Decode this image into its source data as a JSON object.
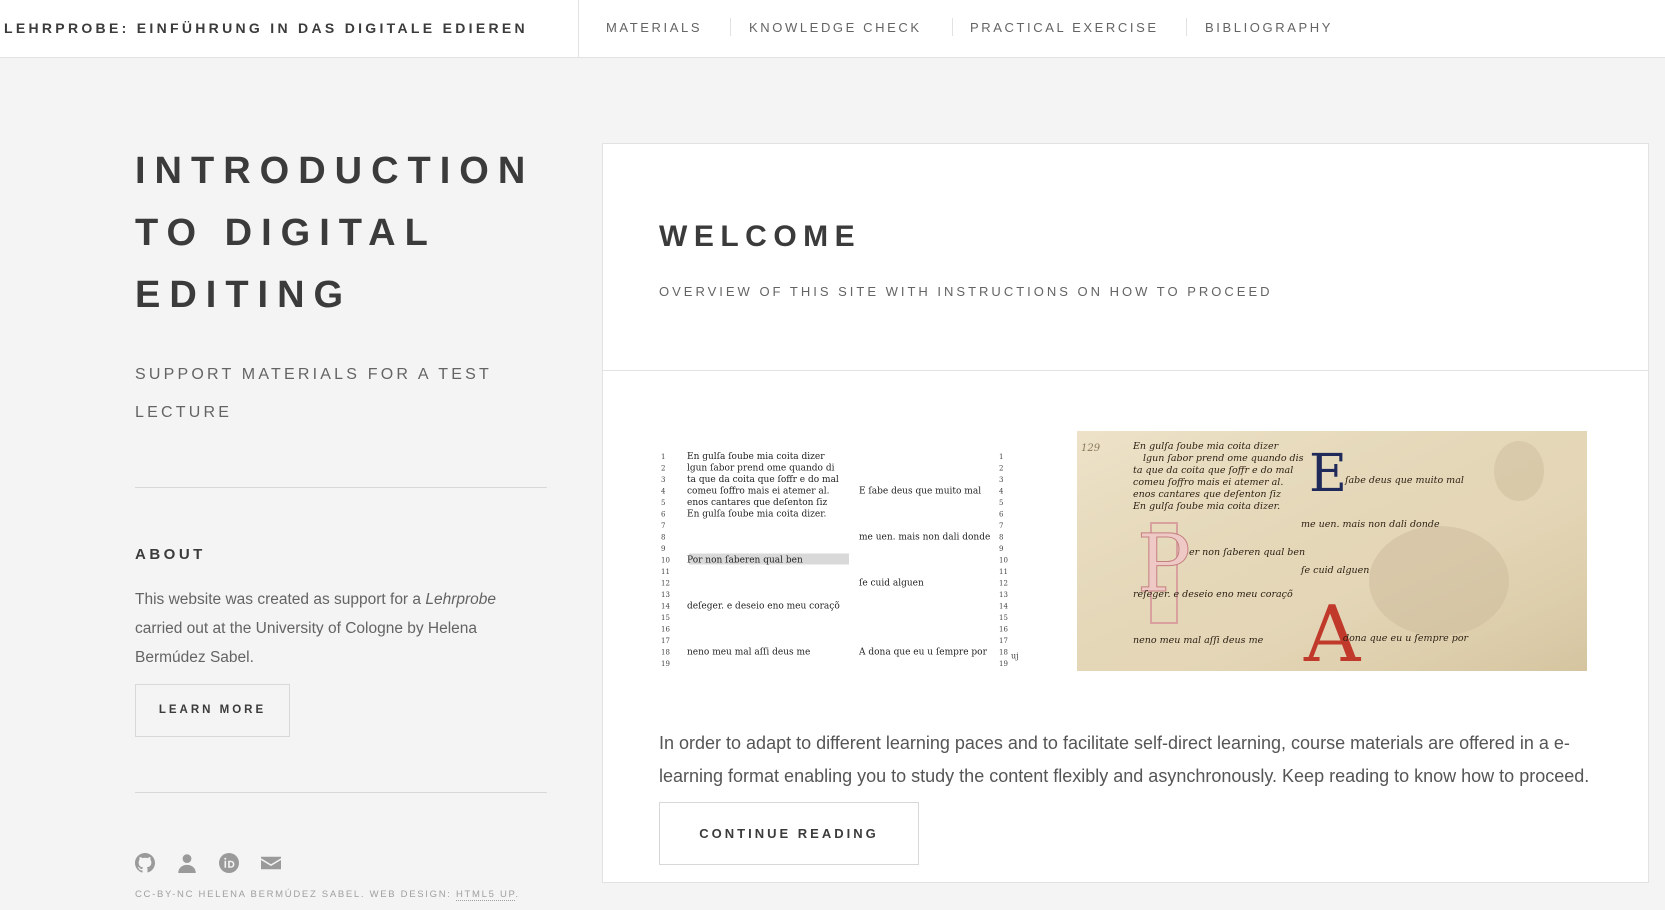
{
  "header": {
    "site_title": "LEHRPROBE: EINFÜHRUNG IN DAS DIGITALE EDIEREN",
    "nav": [
      {
        "label": "MATERIALS"
      },
      {
        "label": "KNOWLEDGE CHECK"
      },
      {
        "label": "PRACTICAL EXERCISE"
      },
      {
        "label": "BIBLIOGRAPHY"
      }
    ]
  },
  "sidebar": {
    "title": "INTRODUCTION TO DIGITAL EDITING",
    "subtitle": "SUPPORT MATERIALS FOR A TEST LECTURE",
    "about_heading": "ABOUT",
    "about_text_1": "This website was created as support for a ",
    "about_text_em": "Lehrprobe",
    "about_text_2": " carried out at the University of Cologne by Helena Bermúdez Sabel.",
    "learn_more_label": "LEARN MORE",
    "social_icons": [
      "github-icon",
      "user-icon",
      "orcid-icon",
      "envelope-icon"
    ],
    "copyright": "CC-BY-NC HELENA BERMÚDEZ SABEL. WEB DESIGN: ",
    "copyright_link": "HTML5 UP",
    "copyright_end": "."
  },
  "post": {
    "title": "WELCOME",
    "subtitle": "OVERVIEW OF THIS SITE WITH INSTRUCTIONS ON HOW TO PROCEED",
    "figure": {
      "left_lines": [
        {
          "n": "1",
          "a": "En gulſa ſoube mia coita dizer",
          "b": ""
        },
        {
          "n": "2",
          "a": "  lgun ſabor prend ome quando di ",
          "b": ""
        },
        {
          "n": "3",
          "a": "ta que da coita que ſoffr e do mal",
          "b": ""
        },
        {
          "n": "4",
          "a": "comeu ſoffro mais ei atemer al.",
          "b": "E ſabe deus que muito mal"
        },
        {
          "n": "5",
          "a": "enos cantares que deſenton ſiz",
          "b": ""
        },
        {
          "n": "6",
          "a": "En gulſa ſoube mia coita dizer.",
          "b": ""
        },
        {
          "n": "7",
          "a": "",
          "b": ""
        },
        {
          "n": "8",
          "a": "",
          "b": "me uen. mais non dali donde"
        },
        {
          "n": "9",
          "a": "",
          "b": ""
        },
        {
          "n": "10",
          "a": "Por non ſaberen qual ben",
          "b": ""
        },
        {
          "n": "11",
          "a": "",
          "b": ""
        },
        {
          "n": "12",
          "a": "",
          "b": "ſe cuid alguen"
        },
        {
          "n": "13",
          "a": "",
          "b": ""
        },
        {
          "n": "14",
          "a": "deſeger. e deseio eno meu coraçõ",
          "b": ""
        },
        {
          "n": "15",
          "a": "",
          "b": ""
        },
        {
          "n": "16",
          "a": "",
          "b": ""
        },
        {
          "n": "17",
          "a": "",
          "b": ""
        },
        {
          "n": "18",
          "a": "neno meu mal aſſi deus me",
          "b": "A dona que eu u ſempre por"
        },
        {
          "n": "19",
          "a": "",
          "b": ""
        }
      ],
      "right_n_suffix": "uj",
      "manuscript_lines": [
        "En gulſa ſoube mia coita dizer",
        "lgun ſabor prend ome quando dis",
        "ta que da coita que ſoffr e do mal",
        "comeu ſoffro mais ei atemer al.",
        "enos cantares que deſenton ſiz",
        "En gulſa ſoube mia coita dizer.",
        "ſabe deus que muito mal",
        "me uen. mais non dali donde",
        "er non ſaberen qual ben",
        "ſe cuid alguen",
        "reſeger. e deseio eno meu coraçõ",
        "neno meu mal aſſi deus me",
        "dona que eu u ſempre por"
      ],
      "folio": "129"
    },
    "body": "In order to adapt to different learning paces and to facilitate self-direct learning, course materials are offered in a e-learning format enabling you to study the content flexibly and asynchronously. Keep reading to know how to proceed.",
    "continue_label": "CONTINUE READING"
  },
  "colors": {
    "accent_red": "#c0392b",
    "accent_blue": "#1f2a5a",
    "parchment": "#e8dcc0"
  }
}
